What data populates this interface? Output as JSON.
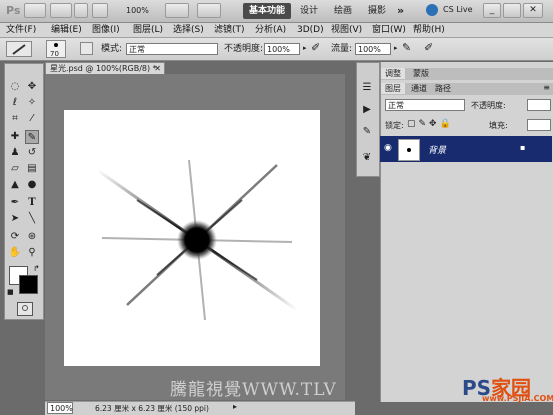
{
  "app": {
    "name": "Ps"
  },
  "appbar": {
    "zoom": "100%",
    "workspaces": [
      "基本功能",
      "设计",
      "绘画",
      "摄影"
    ],
    "active_workspace": 0,
    "overflow": "»",
    "cslive": "CS Live"
  },
  "menu": [
    "文件(F)",
    "编辑(E)",
    "图像(I)",
    "图层(L)",
    "选择(S)",
    "滤镜(T)",
    "分析(A)",
    "3D(D)",
    "视图(V)",
    "窗口(W)",
    "帮助(H)"
  ],
  "options": {
    "brush_size": "70",
    "mode_label": "模式:",
    "mode_value": "正常",
    "opacity_label": "不透明度:",
    "opacity_value": "100%",
    "flow_label": "流量:",
    "flow_value": "100%"
  },
  "document": {
    "tab_title": "星光.psd @ 100%(RGB/8) *",
    "zoom": "100%",
    "status": "6.23 厘米 x 6.23 厘米 (150 ppi)"
  },
  "panels": {
    "top_tabs": [
      "调整",
      "蒙版"
    ],
    "layer_tabs": [
      "图层",
      "通道",
      "路径"
    ],
    "blend_mode": "正常",
    "opacity_label": "不透明度:",
    "lock_label": "锁定:",
    "fill_label": "填充:",
    "layer_name": "背景"
  },
  "watermark": "騰龍視覺WWW.TLV",
  "logo": {
    "main": "PS",
    "suffix": "家园",
    "sub": "www.PSJIA.COM"
  },
  "colors": {
    "accent": "#172b6e",
    "active_workspace_bg": "#4a4a4a"
  },
  "icons": {
    "eye": "eye-icon",
    "lock": "lock-icon"
  }
}
